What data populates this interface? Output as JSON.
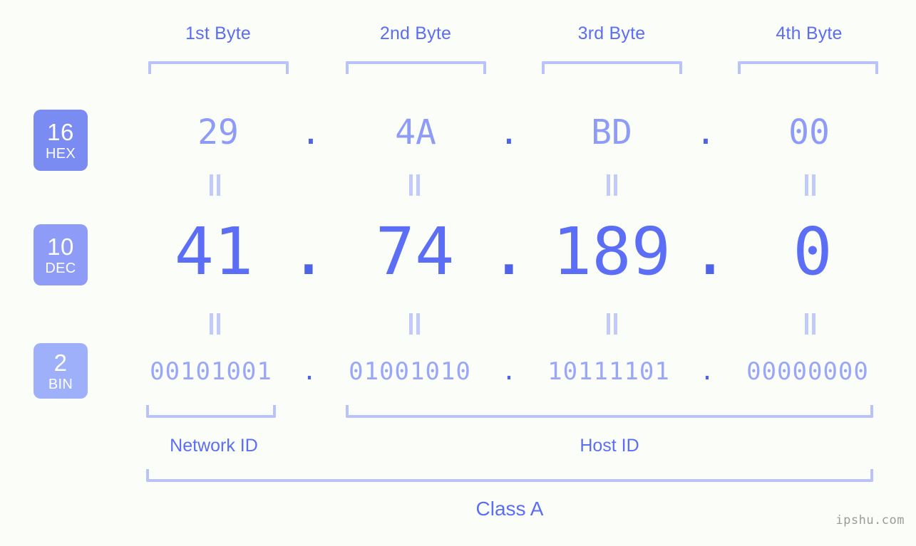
{
  "page": {
    "background_color": "#fbfdf9",
    "accent_color": "#5b6ef5",
    "bracket_color": "#b9c2fb",
    "watermark": "ipshu.com"
  },
  "byte_headers": [
    {
      "label": "1st Byte"
    },
    {
      "label": "2nd Byte"
    },
    {
      "label": "3rd Byte"
    },
    {
      "label": "4th Byte"
    }
  ],
  "rows": [
    {
      "id": "hex",
      "badge": {
        "num": "16",
        "name": "HEX",
        "color": "#7a8bf2"
      },
      "separator": ".",
      "values": [
        "29",
        "4A",
        "BD",
        "00"
      ]
    },
    {
      "id": "dec",
      "badge": {
        "num": "10",
        "name": "DEC",
        "color": "#8e9cf7"
      },
      "separator": ".",
      "values": [
        "41",
        "74",
        "189",
        "0"
      ]
    },
    {
      "id": "bin",
      "badge": {
        "num": "2",
        "name": "BIN",
        "color": "#9fb0fb"
      },
      "separator": ".",
      "values": [
        "00101001",
        "01001010",
        "10111101",
        "00000000"
      ]
    }
  ],
  "equals_symbol": "=",
  "regions": [
    {
      "label": "Network ID"
    },
    {
      "label": "Host ID"
    }
  ],
  "class": {
    "label": "Class A"
  }
}
